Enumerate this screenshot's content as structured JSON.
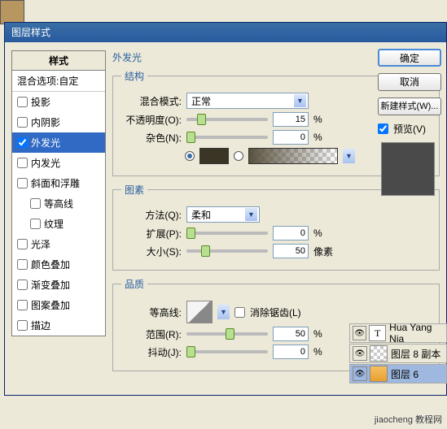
{
  "dialog": {
    "title": "图层样式"
  },
  "styles": {
    "header": "样式",
    "blend": "混合选项:自定",
    "items": [
      {
        "label": "投影",
        "chk": false,
        "sel": false
      },
      {
        "label": "内阴影",
        "chk": false,
        "sel": false
      },
      {
        "label": "外发光",
        "chk": true,
        "sel": true
      },
      {
        "label": "内发光",
        "chk": false,
        "sel": false
      },
      {
        "label": "斜面和浮雕",
        "chk": false,
        "sel": false
      },
      {
        "label": "等高线",
        "chk": false,
        "sel": false,
        "indent": true
      },
      {
        "label": "纹理",
        "chk": false,
        "sel": false,
        "indent": true
      },
      {
        "label": "光泽",
        "chk": false,
        "sel": false
      },
      {
        "label": "颜色叠加",
        "chk": false,
        "sel": false
      },
      {
        "label": "渐变叠加",
        "chk": false,
        "sel": false
      },
      {
        "label": "图案叠加",
        "chk": false,
        "sel": false
      },
      {
        "label": "描边",
        "chk": false,
        "sel": false
      }
    ]
  },
  "panel": {
    "title": "外发光",
    "structure": {
      "legend": "结构",
      "blend_mode_label": "混合模式:",
      "blend_mode_value": "正常",
      "opacity_label": "不透明度(O):",
      "opacity_value": "15",
      "opacity_unit": "%",
      "noise_label": "杂色(N):",
      "noise_value": "0",
      "noise_unit": "%"
    },
    "elements": {
      "legend": "图素",
      "technique_label": "方法(Q):",
      "technique_value": "柔和",
      "spread_label": "扩展(P):",
      "spread_value": "0",
      "spread_unit": "%",
      "size_label": "大小(S):",
      "size_value": "50",
      "size_unit": "像素"
    },
    "quality": {
      "legend": "品质",
      "contour_label": "等高线:",
      "antialias_label": "消除锯齿(L)",
      "range_label": "范围(R):",
      "range_value": "50",
      "range_unit": "%",
      "jitter_label": "抖动(J):",
      "jitter_value": "0",
      "jitter_unit": "%"
    }
  },
  "buttons": {
    "ok": "确定",
    "cancel": "取消",
    "newstyle": "新建样式(W)...",
    "preview": "预览(V)"
  },
  "layers": [
    {
      "name": "Hua Yang Nia",
      "type": "T"
    },
    {
      "name": "图层 8 副本",
      "type": "chk"
    },
    {
      "name": "图层 6",
      "type": "o",
      "sel": true
    }
  ],
  "watermark": "jiaocheng 教程网"
}
